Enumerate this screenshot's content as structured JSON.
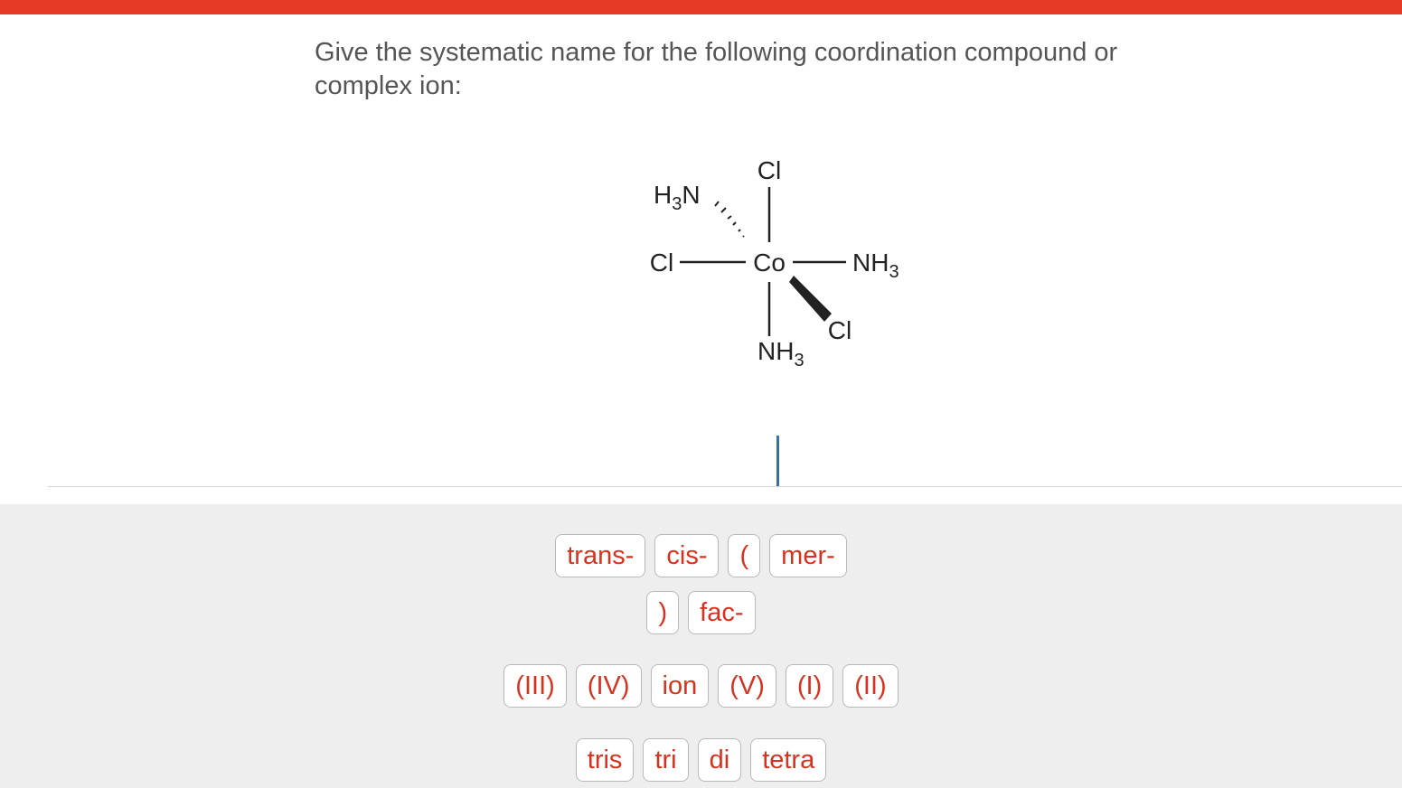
{
  "question": {
    "text": "Give the systematic name for the following coordination compound or complex ion:"
  },
  "molecule": {
    "center": "Co",
    "top": "Cl",
    "upper_left": "H3N",
    "left": "Cl",
    "right": "NH3",
    "bottom": "NH3",
    "lower_right": "Cl"
  },
  "answer": {
    "value": ""
  },
  "tiles": {
    "row1": [
      "trans-",
      "cis-",
      "(",
      "mer-"
    ],
    "row2": [
      ")",
      "fac-"
    ],
    "row3": [
      "(III)",
      "(IV)",
      "ion",
      "(V)",
      "(I)",
      "(II)"
    ],
    "row4": [
      "tris",
      "tri",
      "di",
      "tetra"
    ]
  },
  "colors": {
    "accent_bar": "#e53a26",
    "tile_text": "#d8321f",
    "cursor": "#3a6fa0"
  }
}
